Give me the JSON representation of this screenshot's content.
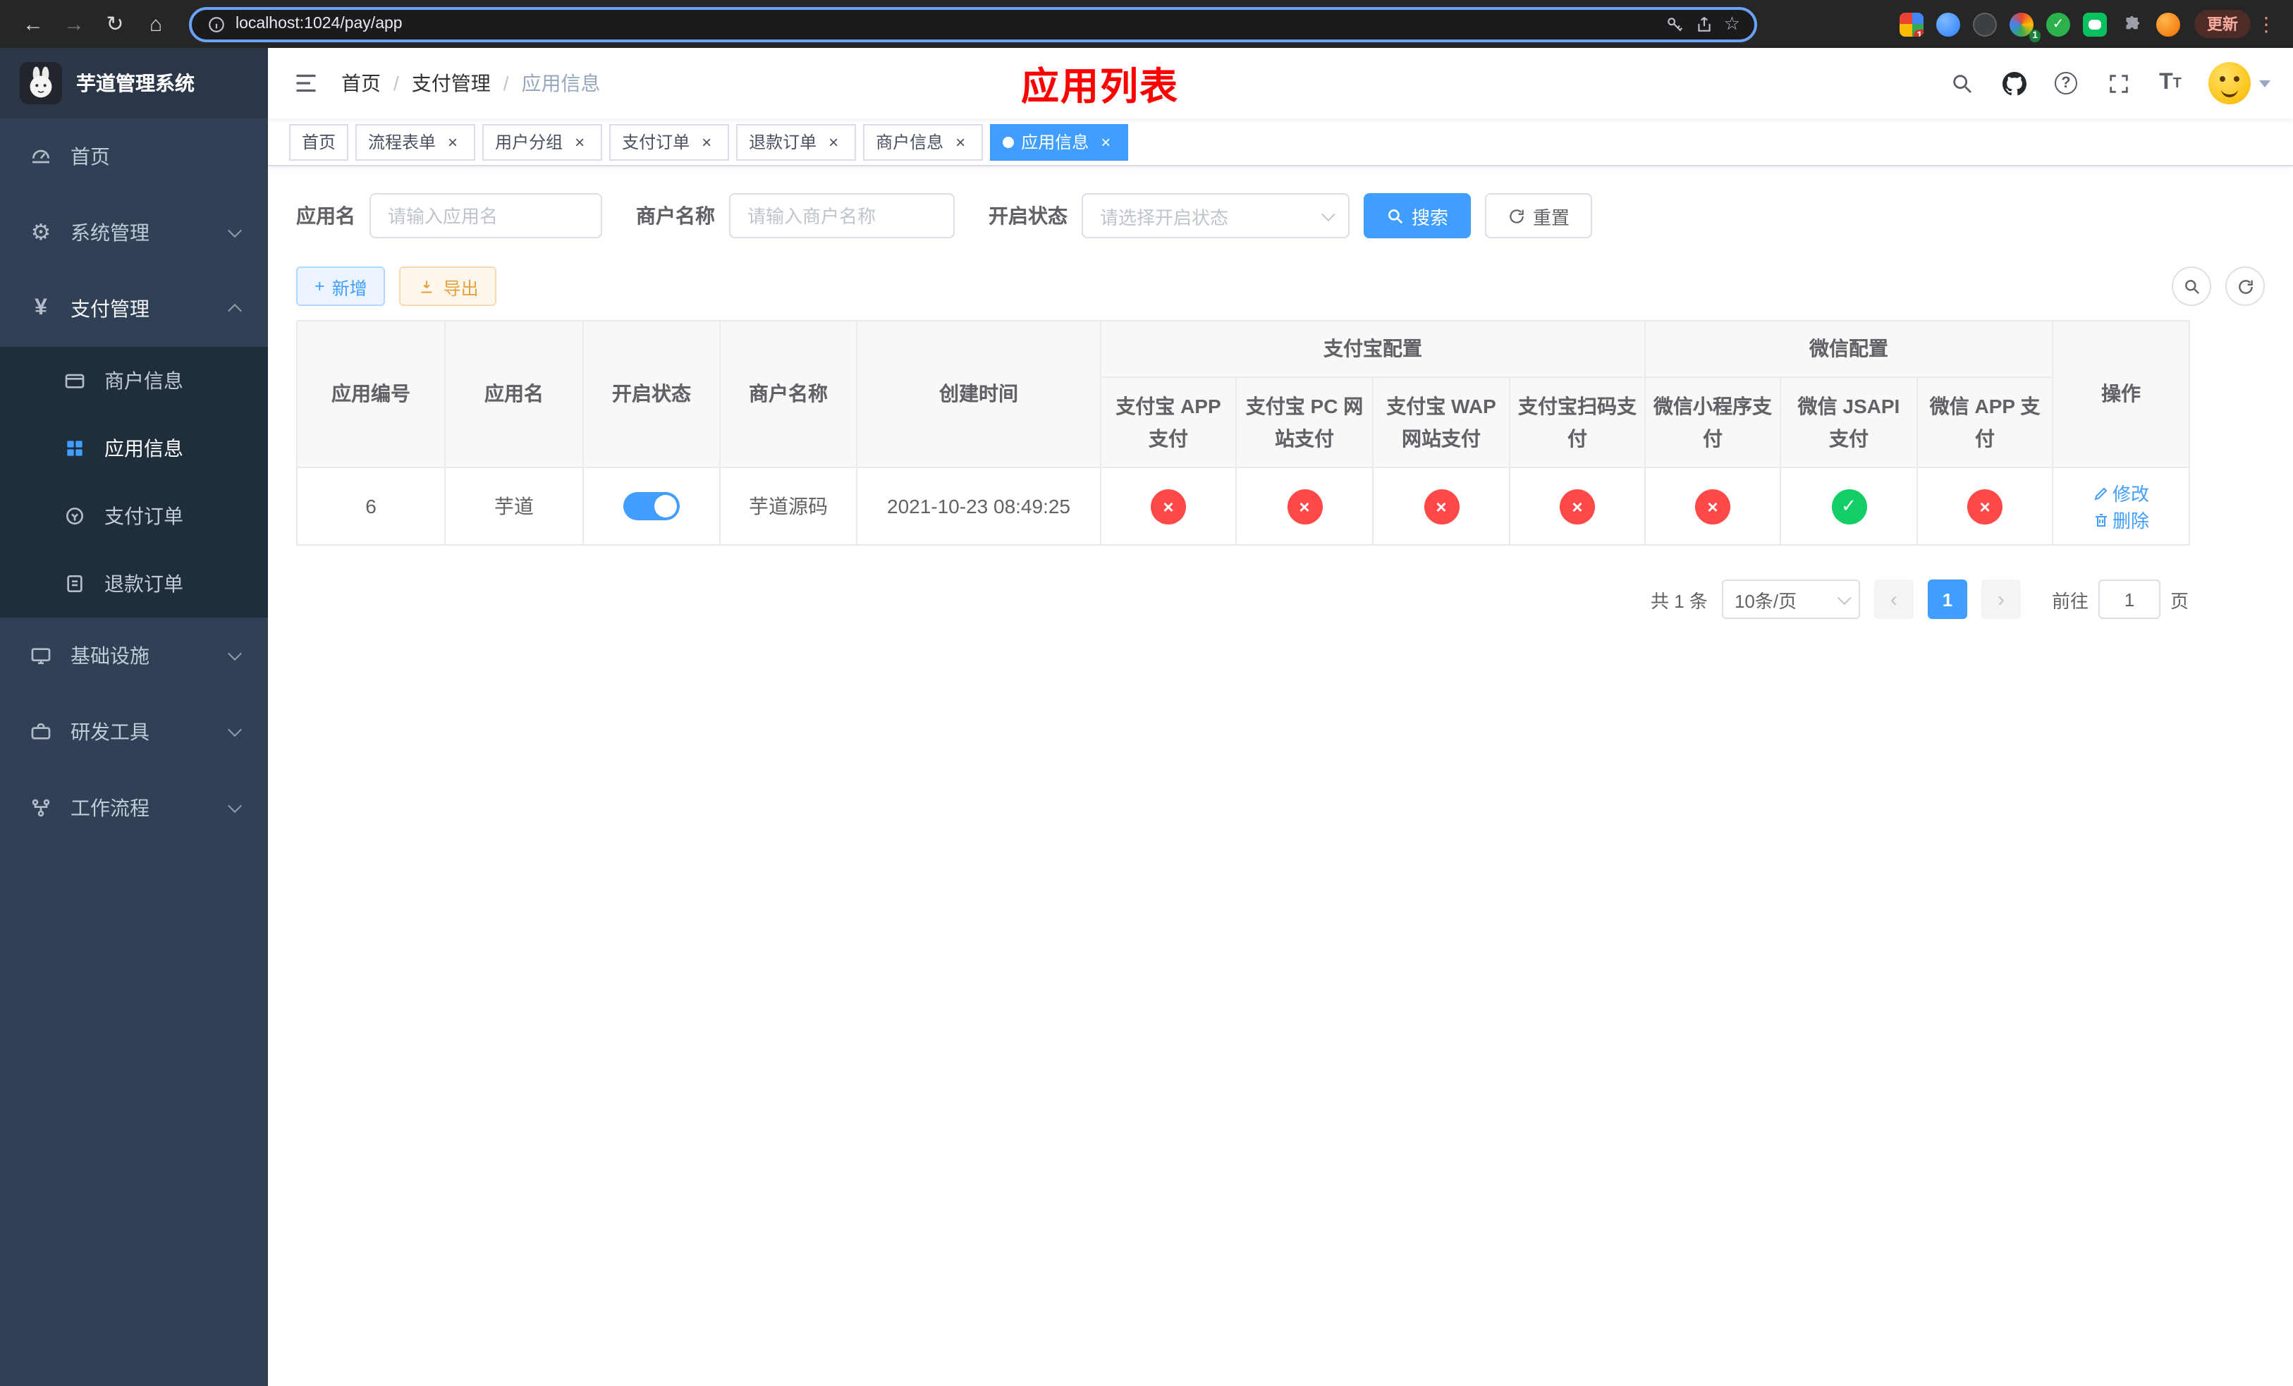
{
  "icons": {
    "back": "←",
    "forward": "→",
    "reload": "↻",
    "home": "⌂",
    "star": "☆",
    "kebab": "⋮",
    "close": "×",
    "check": "✓",
    "cross": "×",
    "prev": "‹",
    "next": "›",
    "plus": "+",
    "separator": "/",
    "gear": "⚙",
    "yen": "¥",
    "question": "?",
    "font_big": "T",
    "font_small": "T"
  },
  "browser": {
    "url": "localhost:1024/pay/app",
    "update_label": "更新",
    "extensions_badge": "10",
    "profile_badge": "1"
  },
  "sidebar": {
    "logo_title": "芋道管理系统",
    "items": [
      {
        "label": "首页"
      },
      {
        "label": "系统管理"
      },
      {
        "label": "支付管理",
        "children": [
          {
            "label": "商户信息"
          },
          {
            "label": "应用信息"
          },
          {
            "label": "支付订单"
          },
          {
            "label": "退款订单"
          }
        ]
      },
      {
        "label": "基础设施"
      },
      {
        "label": "研发工具"
      },
      {
        "label": "工作流程"
      }
    ]
  },
  "navbar": {
    "breadcrumb": [
      {
        "label": "首页"
      },
      {
        "label": "支付管理"
      },
      {
        "label": "应用信息"
      }
    ],
    "page_title": "应用列表"
  },
  "tabs": [
    {
      "label": "首页",
      "closable": false,
      "active": false
    },
    {
      "label": "流程表单",
      "closable": true,
      "active": false
    },
    {
      "label": "用户分组",
      "closable": true,
      "active": false
    },
    {
      "label": "支付订单",
      "closable": true,
      "active": false
    },
    {
      "label": "退款订单",
      "closable": true,
      "active": false
    },
    {
      "label": "商户信息",
      "closable": true,
      "active": false
    },
    {
      "label": "应用信息",
      "closable": true,
      "active": true
    }
  ],
  "filters": {
    "app_name_label": "应用名",
    "app_name_placeholder": "请输入应用名",
    "merchant_label": "商户名称",
    "merchant_placeholder": "请输入商户名称",
    "status_label": "开启状态",
    "status_placeholder": "请选择开启状态",
    "search_label": "搜索",
    "reset_label": "重置"
  },
  "toolbar": {
    "add_label": "新增",
    "export_label": "导出"
  },
  "table": {
    "columns_main": [
      "应用编号",
      "应用名",
      "开启状态",
      "商户名称",
      "创建时间"
    ],
    "group_alipay": "支付宝配置",
    "group_wechat": "微信配置",
    "columns_alipay": [
      "支付宝 APP 支付",
      "支付宝 PC 网站支付",
      "支付宝 WAP 网站支付",
      "支付宝扫码支付"
    ],
    "columns_wechat": [
      "微信小程序支付",
      "微信 JSAPI 支付",
      "微信 APP 支付"
    ],
    "column_action": "操作",
    "rows": [
      {
        "id": "6",
        "name": "芋道",
        "enabled": true,
        "merchant": "芋道源码",
        "created_at": "2021-10-23 08:49:25",
        "statuses": {
          "alipay_app": false,
          "alipay_pc": false,
          "alipay_wap": false,
          "alipay_qr": false,
          "wechat_mini": false,
          "wechat_jsapi": true,
          "wechat_app": false
        },
        "actions": {
          "edit": "修改",
          "delete": "删除"
        }
      }
    ]
  },
  "pagination": {
    "total": "共 1 条",
    "page_size": "10条/页",
    "current_page": "1",
    "goto": "前往",
    "unit": "页",
    "goto_value": "1"
  },
  "colors": {
    "primary": "#409eff",
    "success": "#13ce66",
    "danger": "#ff4949",
    "title_red": "#ff0000",
    "sidebar_bg": "#304156",
    "submenu_bg": "#1f2d3d"
  }
}
